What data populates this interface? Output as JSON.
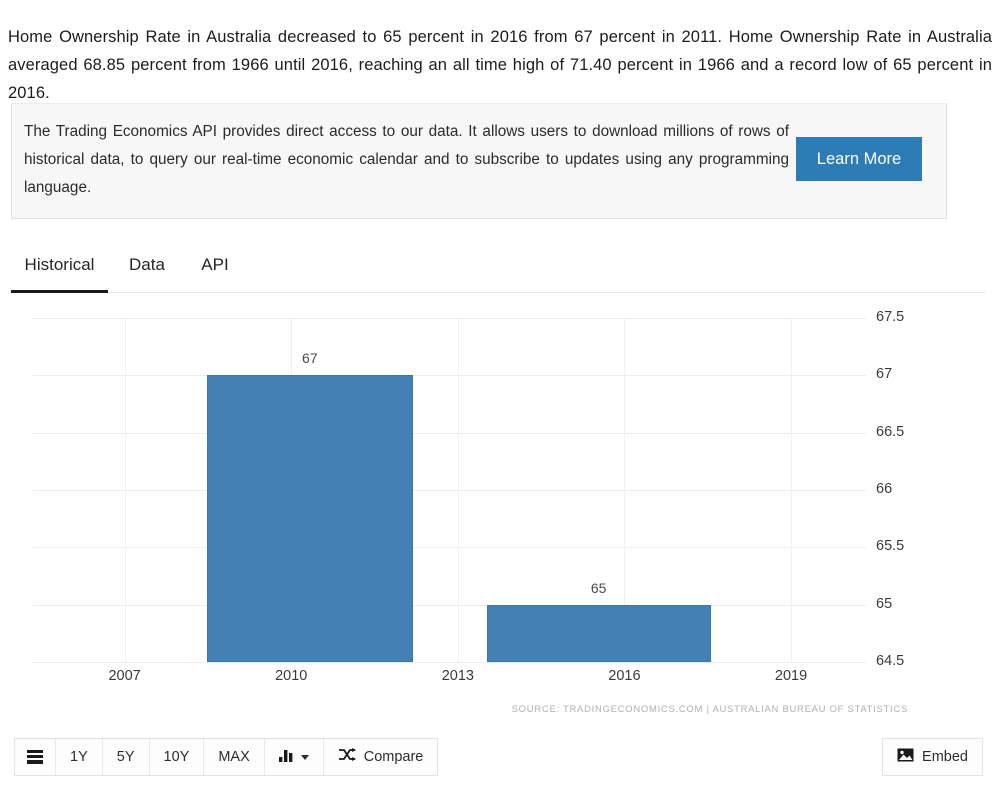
{
  "summary": {
    "text": "Home Ownership Rate in Australia decreased to 65 percent in 2016 from 67 percent in 2011. Home Ownership Rate in Australia averaged 68.85 percent from 1966 until 2016, reaching an all time high of 71.40 percent in 1966 and a record low of 65 percent in 2016."
  },
  "api_promo": {
    "text": "The Trading Economics API provides direct access to our data. It allows users to download millions of rows of historical data, to query our real-time economic calendar and to subscribe to updates using any programming language.",
    "button_label": "Learn More",
    "button_color": "#2e7cb5"
  },
  "tabs": [
    {
      "label": "Historical",
      "active": true
    },
    {
      "label": "Data",
      "active": false
    },
    {
      "label": "API",
      "active": false
    }
  ],
  "toolbar": {
    "menu_icon": "menu-icon",
    "ranges": [
      "1Y",
      "5Y",
      "10Y",
      "MAX"
    ],
    "chart_type_icon": "bar-chart-icon",
    "compare_icon": "shuffle-icon",
    "compare_label": "Compare",
    "embed_icon": "image-icon",
    "embed_label": "Embed"
  },
  "chart_data": {
    "type": "bar",
    "title": "",
    "xlabel": "",
    "ylabel": "",
    "categories": [
      "2011",
      "2016"
    ],
    "values": [
      67,
      65
    ],
    "data_labels": [
      "67",
      "65"
    ],
    "bar_color": "#4480b4",
    "ylim": [
      64.5,
      67.5
    ],
    "yticks": [
      "67.5",
      "67",
      "66.5",
      "66",
      "65.5",
      "65",
      "64.5"
    ],
    "ytick_values": [
      67.5,
      67,
      66.5,
      66,
      65.5,
      65,
      64.5
    ],
    "xticks": [
      "2007",
      "2010",
      "2013",
      "2016",
      "2019"
    ],
    "xtick_values": [
      2007,
      2010,
      2013,
      2016,
      2019
    ],
    "grid": true,
    "legend": false,
    "source": "SOURCE: TRADINGECONOMICS.COM | AUSTRALIAN BUREAU OF STATISTICS"
  }
}
